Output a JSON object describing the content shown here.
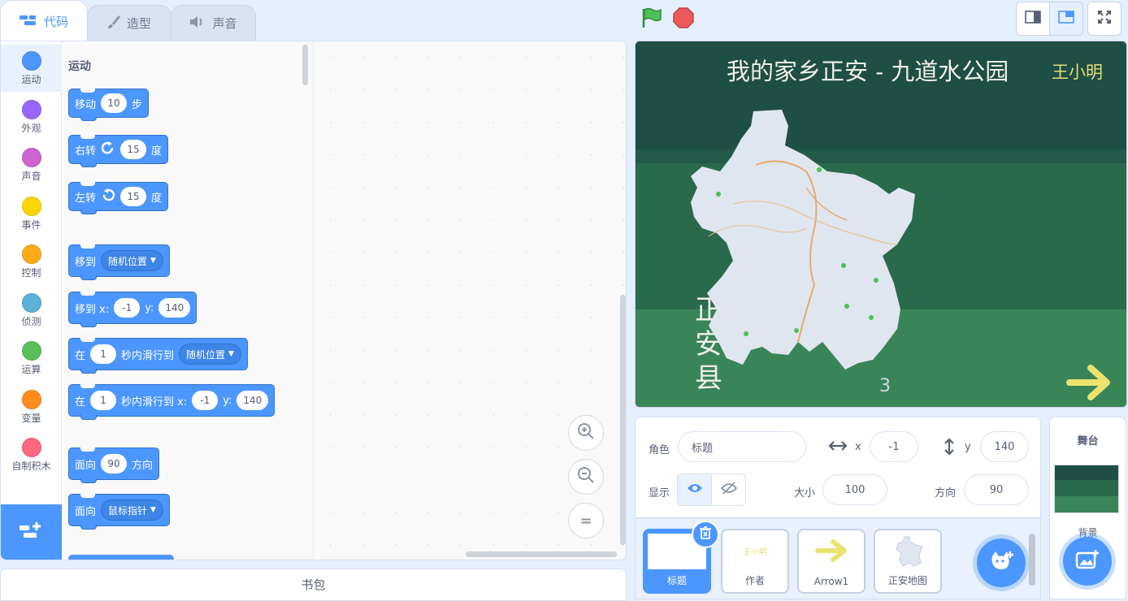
{
  "tabs": [
    {
      "label": "代码",
      "icon": "code-icon",
      "active": true
    },
    {
      "label": "造型",
      "icon": "brush-icon",
      "active": false
    },
    {
      "label": "声音",
      "icon": "speaker-icon",
      "active": false
    }
  ],
  "categories": [
    {
      "label": "运动",
      "color": "#4c97ff"
    },
    {
      "label": "外观",
      "color": "#9966ff"
    },
    {
      "label": "声音",
      "color": "#cf63cf"
    },
    {
      "label": "事件",
      "color": "#ffd500"
    },
    {
      "label": "控制",
      "color": "#ffab19"
    },
    {
      "label": "侦测",
      "color": "#5cb1d6"
    },
    {
      "label": "运算",
      "color": "#59c059"
    },
    {
      "label": "变量",
      "color": "#ff8c1a"
    },
    {
      "label": "自制积木",
      "color": "#ff6680"
    }
  ],
  "palette": {
    "section_title": "运动",
    "blocks": {
      "move": {
        "label": "移动",
        "value": "10",
        "suffix": "步"
      },
      "turn_right": {
        "label": "右转",
        "value": "15",
        "suffix": "度"
      },
      "turn_left": {
        "label": "左转",
        "value": "15",
        "suffix": "度"
      },
      "goto": {
        "label": "移到",
        "dropdown": "随机位置"
      },
      "goto_xy": {
        "label": "移到 x:",
        "x": "-1",
        "ylabel": "y:",
        "y": "140"
      },
      "glide": {
        "label": "在",
        "secs": "1",
        "mid": "秒内滑行到",
        "dropdown": "随机位置"
      },
      "glide_xy": {
        "label": "在",
        "secs": "1",
        "mid": "秒内滑行到 x:",
        "x": "-1",
        "ylabel": "y:",
        "y": "140"
      },
      "point_dir": {
        "label": "面向",
        "value": "90",
        "suffix": "方向"
      },
      "point_towards": {
        "label": "面向",
        "dropdown": "鼠标指针"
      }
    }
  },
  "zoom": {
    "in": "+",
    "out": "−",
    "reset": "="
  },
  "backpack_label": "书包",
  "stage": {
    "title": "我的家乡正安 - 九道水公园",
    "author": "王小明",
    "county": [
      "正",
      "安",
      "县"
    ],
    "corner_number": "3",
    "colors": {
      "top": "#1e4e44",
      "middle": "#2a6a4c",
      "bottom": "#398558",
      "arrow": "#ece36e"
    }
  },
  "sprite_info": {
    "sprite_label": "角色",
    "sprite_name": "标题",
    "x_label": "x",
    "x": "-1",
    "y_label": "y",
    "y": "140",
    "show_label": "显示",
    "size_label": "大小",
    "size": "100",
    "direction_label": "方向",
    "direction": "90"
  },
  "sprites": [
    {
      "name": "标题",
      "selected": true
    },
    {
      "name": "作者",
      "thumb_text": "王小明"
    },
    {
      "name": "Arrow1"
    },
    {
      "name": "正安地图"
    }
  ],
  "stage_panel": {
    "title": "舞台",
    "backdrop_label": "背景"
  }
}
